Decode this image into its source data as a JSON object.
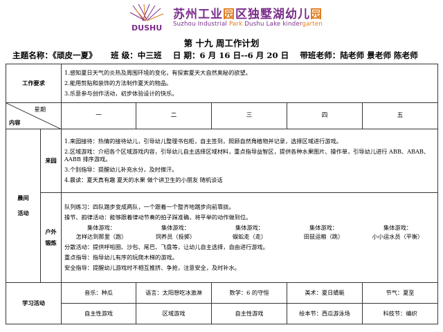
{
  "header": {
    "logo_text": "DUSHU",
    "school_name_a": "苏州工业",
    "school_name_b": "园",
    "school_name_c": "区独墅湖幼儿",
    "school_name_d": "园",
    "school_name_en_a": "Suzhou Industrial ",
    "school_name_en_b": "Park",
    "school_name_en_c": " Dushu Lake kinder",
    "school_name_en_d": "garten"
  },
  "title": "第 十九 周工作计划",
  "info": {
    "theme_label": "主题名称：",
    "theme_value": "《顽皮一夏》",
    "class_label": "班  级：",
    "class_value": "中三班",
    "date_label": "日  期：",
    "date_value": "6 月 16 日--6 月 20 日",
    "teacher_label": "带班老师：",
    "teacher_value": "陆老师  景老师  陈老师"
  },
  "requirements": {
    "label": "工作要求",
    "items": [
      "1.感知夏日天气的炎热及周围环境的变化，有探索夏天大自然奥秘的欲望。",
      "2.能用剪贴和装饰的方法制作夏天的物品。",
      "3.乐意参与创作活动，初步体验设计的快乐。"
    ]
  },
  "week_header": {
    "corner_top": "星期",
    "corner_bottom": "内容",
    "days": [
      "一",
      "二",
      "三",
      "四",
      "五"
    ]
  },
  "morning": {
    "label_a": "晨间",
    "label_b": "活动",
    "arrival_label": "来园",
    "arrival_items": [
      "1.来园接待：热情的接待幼儿，引导幼儿整理书包柜，自主签到，照顾自然角植物并记录，选择区域进行游戏。",
      "2.区域游戏：介绍各个区域游戏内容，引导幼儿自主选择区域材料，重点指导益智区，提供各种水果图片、操作单，引导幼儿进行 ABB、ABAB、AABB 排序游戏。",
      "3.个别指导：提醒幼儿补充水分，及时擦汗。",
      "4.晨读：夏天真有趣   夏天的水果   做个讲卫生的小朋友   随机谈话"
    ],
    "outdoor_label_a": "户外",
    "outdoor_label_b": "锻炼",
    "queue": "队列练习：四队踏步变成两队，一个跟着一个整齐地踏步向前靠拢。",
    "exercise": "操节、韵律活动：能够跟着律动节奏的拍子踩准确，将平举的动作做到位。",
    "group_games": [
      {
        "title": "集体游戏：",
        "name": "怎样达到那里（跑）"
      },
      {
        "title": "集体游戏：",
        "name": "饲养员（投掷）"
      },
      {
        "title": "集体游戏：",
        "name": "蜈蚣走（走）"
      },
      {
        "title": "集体游戏：",
        "name": "田鼠运粮（跳）"
      },
      {
        "title": "集体游戏：",
        "name": "小小运水员（平衡）"
      }
    ],
    "free_play": "分散活动：提供呼啦圈、沙包、尾巴、飞盘等，让幼儿自主选择，自由进行游戏。",
    "key_guidance": "重点指导：指导幼儿有序的玩爬木梯的游戏。",
    "safety": "安全指导：提醒幼儿游戏时不相互推挤、争抢，注意安全，及时补水。"
  },
  "study": {
    "label": "学习活动",
    "row1": [
      "音乐：种瓜",
      "语言：太阳想吃冰激淋",
      "数学：6 的守恒",
      "美术：夏日蜻蜓",
      "节气：夏至"
    ],
    "row2": [
      "自主性游戏",
      "区域游戏",
      "自主性游戏",
      "绘本节：西瓜游泳场",
      "科技节：编织"
    ]
  }
}
